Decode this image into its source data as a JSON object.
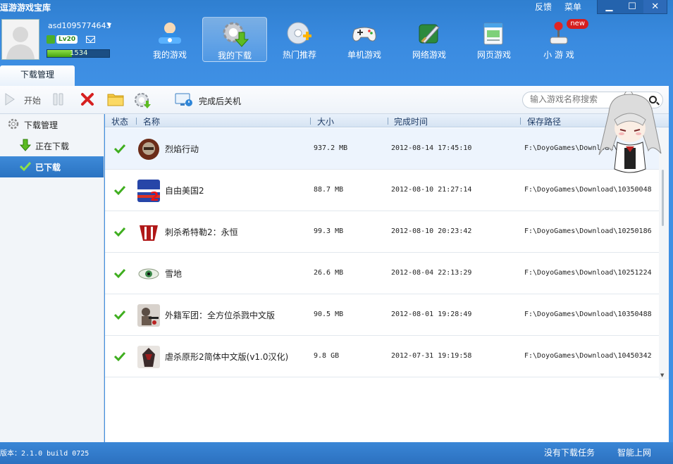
{
  "app": {
    "title": "逗游游戏宝库",
    "feedback": "反馈",
    "menu": "菜单"
  },
  "user": {
    "name": "asd1095774643",
    "level": "Lv20",
    "exp": "1534",
    "exp_fill": 0.4
  },
  "nav": [
    {
      "label": "我的游戏",
      "icon": "my-games-icon"
    },
    {
      "label": "我的下载",
      "icon": "download-gear-icon",
      "active": true
    },
    {
      "label": "热门推荐",
      "icon": "hot-disc-icon"
    },
    {
      "label": "单机游戏",
      "icon": "gamepad-icon"
    },
    {
      "label": "网络游戏",
      "icon": "sword-icon"
    },
    {
      "label": "网页游戏",
      "icon": "webpage-icon"
    },
    {
      "label": "小 游 戏",
      "icon": "joystick-icon",
      "badge": "new"
    }
  ],
  "tab": "下载管理",
  "toolbar": {
    "start": "开始",
    "shutdown": "完成后关机",
    "search_placeholder": "输入游戏名称搜索"
  },
  "sidebar": {
    "header": "下载管理",
    "downloading": "正在下载",
    "downloaded": "已下载"
  },
  "table": {
    "headers": {
      "status": "状态",
      "name": "名称",
      "size": "大小",
      "time": "完成时间",
      "path": "保存路径"
    },
    "rows": [
      {
        "name": "烈焰行动",
        "size": "937.2 MB",
        "time": "2012-08-14 17:45:10",
        "path": "F:\\DoyoGames\\Download\\"
      },
      {
        "name": "自由美国2",
        "size": "88.7 MB",
        "time": "2012-08-10 21:27:14",
        "path": "F:\\DoyoGames\\Download\\10350048"
      },
      {
        "name": "刺杀希特勒2：永恒",
        "size": "99.3 MB",
        "time": "2012-08-10 20:23:42",
        "path": "F:\\DoyoGames\\Download\\10250186"
      },
      {
        "name": "雪地",
        "size": "26.6 MB",
        "time": "2012-08-04 22:13:29",
        "path": "F:\\DoyoGames\\Download\\10251224"
      },
      {
        "name": "外籍军团：全方位杀戮中文版",
        "size": "90.5 MB",
        "time": "2012-08-01 19:28:49",
        "path": "F:\\DoyoGames\\Download\\10350488"
      },
      {
        "name": "虐杀原形2简体中文版(v1.0汉化)",
        "size": "9.8 GB",
        "time": "2012-07-31 19:19:58",
        "path": "F:\\DoyoGames\\Download\\10450342"
      }
    ]
  },
  "status": {
    "version": "版本：2.1.0 build 0725",
    "no_tasks": "没有下载任务",
    "smart_net": "智能上网"
  },
  "colors": {
    "accent": "#2f7fd0",
    "check": "#3fae1f",
    "close_red": "#d62020"
  }
}
